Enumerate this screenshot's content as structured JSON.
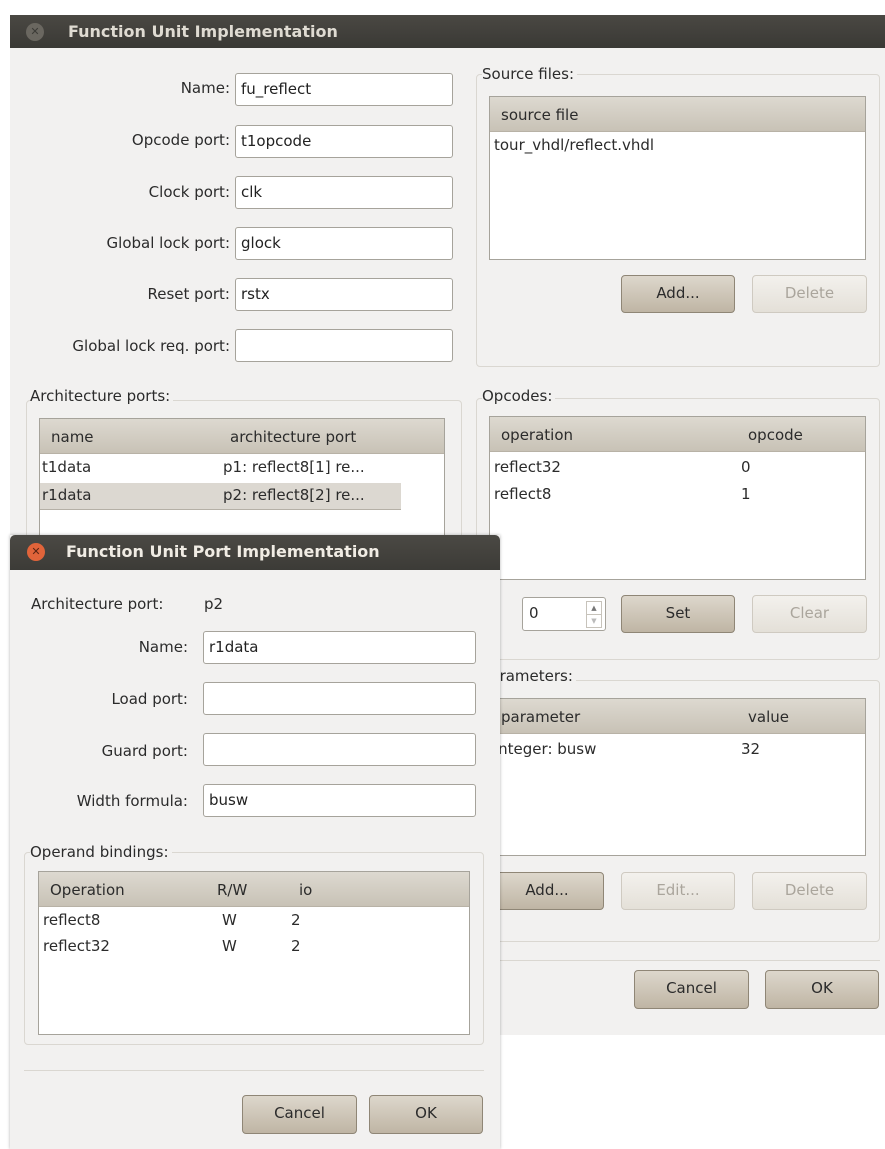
{
  "main": {
    "title": "Function Unit Implementation",
    "fields": {
      "name_label": "Name:",
      "name_value": "fu_reflect",
      "opcode_label": "Opcode port:",
      "opcode_value": "t1opcode",
      "clock_label": "Clock port:",
      "clock_value": "clk",
      "glock_label": "Global lock port:",
      "glock_value": "glock",
      "reset_label": "Reset port:",
      "reset_value": "rstx",
      "glockreq_label": "Global lock req. port:",
      "glockreq_value": ""
    },
    "source_files": {
      "label": "Source files:",
      "header": "source file",
      "rows": [
        "tour_vhdl/reflect.vhdl"
      ],
      "add": "Add...",
      "delete": "Delete"
    },
    "arch_ports": {
      "label": "Architecture ports:",
      "headers": [
        "name",
        "architecture port"
      ],
      "rows": [
        [
          "t1data",
          "p1: reflect8[1] re..."
        ],
        [
          "r1data",
          "p2: reflect8[2] re..."
        ]
      ]
    },
    "opcodes": {
      "label": "Opcodes:",
      "headers": [
        "operation",
        "opcode"
      ],
      "rows": [
        [
          "reflect32",
          "0"
        ],
        [
          "reflect8",
          "1"
        ]
      ],
      "spin_value": "0",
      "set": "Set",
      "clear": "Clear"
    },
    "parameters": {
      "label": "Parameters:",
      "headers": [
        "parameter",
        "value"
      ],
      "rows": [
        [
          "integer: busw",
          "32"
        ]
      ],
      "add": "Add...",
      "edit": "Edit...",
      "delete": "Delete"
    },
    "cancel": "Cancel",
    "ok": "OK"
  },
  "port_dialog": {
    "title": "Function Unit Port Implementation",
    "arch_port_label": "Architecture port:",
    "arch_port_value": "p2",
    "name_label": "Name:",
    "name_value": "r1data",
    "load_label": "Load port:",
    "load_value": "",
    "guard_label": "Guard port:",
    "guard_value": "",
    "width_label": "Width formula:",
    "width_value": "busw",
    "bindings": {
      "label": "Operand bindings:",
      "headers": [
        "Operation",
        "R/W",
        "io"
      ],
      "rows": [
        [
          "reflect8",
          "W",
          "2"
        ],
        [
          "reflect32",
          "W",
          "2"
        ]
      ]
    },
    "cancel": "Cancel",
    "ok": "OK"
  },
  "colors": {
    "titlebar": "#3c3b37",
    "close_active": "#e1643a",
    "button": "#c9c0b0",
    "window_bg": "#f2f1f0"
  }
}
